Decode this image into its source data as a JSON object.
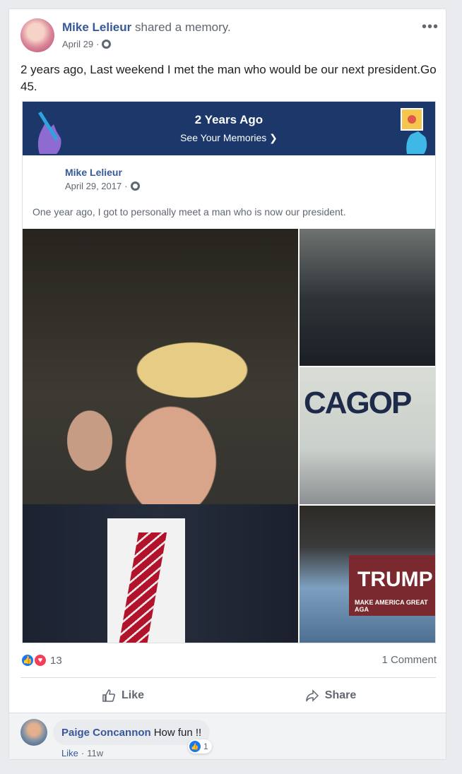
{
  "post": {
    "author": "Mike Lelieur",
    "action": "shared a memory.",
    "date": "April 29",
    "separator": "·",
    "text": "2 years ago, Last weekend I met the man who would be our next president.Go 45.",
    "more_icon": "more-icon",
    "privacy_icon": "globe-icon"
  },
  "memory": {
    "banner_title": "2 Years Ago",
    "banner_link": "See Your Memories",
    "banner_link_icon": "chevron-right-icon",
    "original_author": "Mike Lelieur",
    "original_date": "April 29, 2017",
    "original_text": "One year ago, I got to personally meet a man who is now our president.",
    "photo_texts": {
      "cagop": "CAGOP",
      "trump": "TRUMP",
      "maga": "MAKE AMERICA GREAT AGA"
    }
  },
  "reactions": {
    "count": "13",
    "like_icon": "like-reaction-icon",
    "love_icon": "love-reaction-icon"
  },
  "comments_count": "1 Comment",
  "actions": {
    "like": "Like",
    "share": "Share"
  },
  "comment": {
    "author": "Paige Concannon",
    "text": "How fun !!",
    "reaction_count": "1",
    "like_label": "Like",
    "separator": "·",
    "age": "11w"
  },
  "colors": {
    "link": "#385898",
    "banner": "#1c3769",
    "like": "#1877f2",
    "love": "#f33e58"
  }
}
